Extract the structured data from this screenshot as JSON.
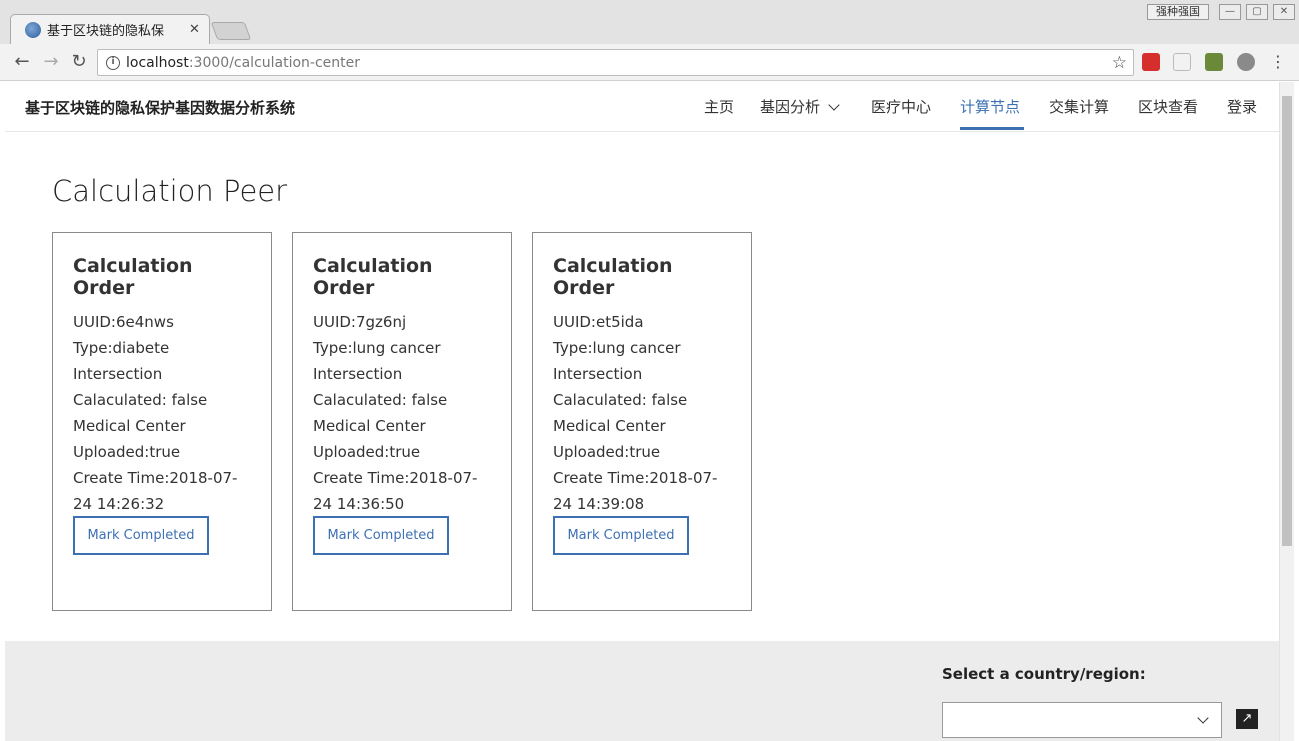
{
  "browser": {
    "tab_title": "基于区块链的隐私保",
    "tab_close": "✕",
    "window_extra_label": "强种强国",
    "url_host": "localhost",
    "url_rest": ":3000/calculation-center"
  },
  "header": {
    "brand": "基于区块链的隐私保护基因数据分析系统",
    "nav": {
      "home": "主页",
      "gene_analysis": "基因分析",
      "medical_center": "医疗中心",
      "compute_node": "计算节点",
      "intersection": "交集计算",
      "block_view": "区块查看",
      "login": "登录"
    }
  },
  "main": {
    "title": "Calculation Peer",
    "cards": [
      {
        "title": "Calculation Order",
        "uuid": "UUID:6e4nws",
        "type": "Type:diabete",
        "category": "Intersection",
        "calculated": "Calaculated: false",
        "center": "Medical Center",
        "uploaded": "Uploaded:true",
        "create_time_1": "Create Time:2018-07-",
        "create_time_2": "24 14:26:32",
        "button": "Mark Completed"
      },
      {
        "title": "Calculation Order",
        "uuid": "UUID:7gz6nj",
        "type": "Type:lung cancer",
        "category": "Intersection",
        "calculated": "Calaculated: false",
        "center": "Medical Center",
        "uploaded": "Uploaded:true",
        "create_time_1": "Create Time:2018-07-",
        "create_time_2": "24 14:36:50",
        "button": "Mark Completed"
      },
      {
        "title": "Calculation Order",
        "uuid": "UUID:et5ida",
        "type": "Type:lung cancer",
        "category": "Intersection",
        "calculated": "Calaculated: false",
        "center": "Medical Center",
        "uploaded": "Uploaded:true",
        "create_time_1": "Create Time:2018-07-",
        "create_time_2": "24 14:39:08",
        "button": "Mark Completed"
      }
    ]
  },
  "footer": {
    "country_label": "Select a country/region:",
    "country_value": ""
  },
  "icons": {
    "back": "back-arrow-icon",
    "forward": "forward-arrow-icon",
    "reload": "reload-icon",
    "info": "info-icon",
    "star": "star-icon",
    "menu": "kebab-menu-icon",
    "external": "external-link-icon"
  },
  "colors": {
    "accent": "#3d70b2",
    "footer_bg": "#ececec"
  }
}
